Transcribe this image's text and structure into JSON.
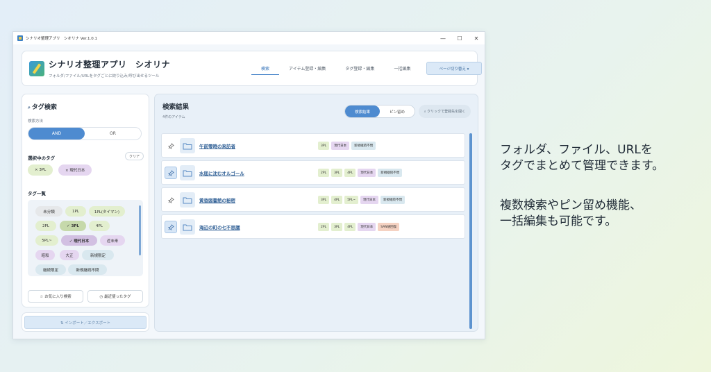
{
  "window": {
    "title": "シナリオ整理アプリ　シオリナ Ver.1.0.1",
    "controls": {
      "minimize": "—",
      "maximize": "☐",
      "close": "✕"
    }
  },
  "header": {
    "title": "シナリオ整理アプリ　シオリナ",
    "subtitle": "フォルダ/ファイル/URLをタグごとに絞り込み/呼び出せるツール",
    "tabs": [
      "検索",
      "アイテム登録・編集",
      "タグ登録・編集",
      "一括編集"
    ],
    "active_tab": 0,
    "page_switch": "ページ切り替え ▾"
  },
  "sidebar": {
    "title": "タグ検索",
    "search_mode_label": "検索方法",
    "mode_options": [
      "AND",
      "OR"
    ],
    "selected_label": "選択中のタグ",
    "clear": "クリア",
    "selected_tags": [
      "× 3PL",
      "× 現代日本"
    ],
    "tag_list_label": "タグ一覧",
    "tags": [
      {
        "text": "未分類",
        "color": "gray"
      },
      {
        "text": "1PL",
        "color": "green"
      },
      {
        "text": "1PL(タイマン)",
        "color": "green"
      },
      {
        "text": "2PL",
        "color": "green"
      },
      {
        "text": "✓ 3PL",
        "color": "greensel"
      },
      {
        "text": "4PL",
        "color": "green"
      },
      {
        "text": "5PL~",
        "color": "green"
      },
      {
        "text": "✓ 現代日本",
        "color": "purplesel"
      },
      {
        "text": "近未来",
        "color": "purple"
      },
      {
        "text": "昭和",
        "color": "purple"
      },
      {
        "text": "大正",
        "color": "purple"
      },
      {
        "text": "新規限定",
        "color": "blue"
      },
      {
        "text": "継続限定",
        "color": "blue"
      },
      {
        "text": "新規継続不問",
        "color": "blue"
      }
    ],
    "favorites": "☆ お気に入り検索",
    "recent": "◷ 最近使ったタグ",
    "import_export": "⇅ インポート／エクスポート"
  },
  "results": {
    "title": "検索結果",
    "count": "4件のアイテム",
    "view_options": [
      "検索結果",
      "ピン留め"
    ],
    "open_folder": "⌕ クリックで登録先を開く",
    "items": [
      {
        "name": "午前零時の来訪者",
        "pinned": false,
        "tags": [
          {
            "text": "3PL",
            "color": "green"
          },
          {
            "text": "現代日本",
            "color": "purple"
          },
          {
            "text": "新規継続不問",
            "color": "blue"
          }
        ]
      },
      {
        "name": "水底に沈むオルゴール",
        "pinned": true,
        "tags": [
          {
            "text": "2PL",
            "color": "green"
          },
          {
            "text": "3PL",
            "color": "green"
          },
          {
            "text": "4PL",
            "color": "green"
          },
          {
            "text": "現代日本",
            "color": "purple"
          },
          {
            "text": "新規継続不問",
            "color": "blue"
          }
        ]
      },
      {
        "name": "黄昏図書館の秘密",
        "pinned": false,
        "tags": [
          {
            "text": "3PL",
            "color": "green"
          },
          {
            "text": "4PL",
            "color": "green"
          },
          {
            "text": "5PL~",
            "color": "green"
          },
          {
            "text": "現代日本",
            "color": "purple"
          },
          {
            "text": "新規継続不問",
            "color": "blue"
          }
        ]
      },
      {
        "name": "海辺の町の七不思議",
        "pinned": true,
        "tags": [
          {
            "text": "2PL",
            "color": "green"
          },
          {
            "text": "3PL",
            "color": "green"
          },
          {
            "text": "4PL",
            "color": "green"
          },
          {
            "text": "現代日本",
            "color": "purple"
          },
          {
            "text": "SAN値回復",
            "color": "orange"
          }
        ]
      }
    ]
  },
  "promo": {
    "line1": "フォルダ、ファイル、URLを",
    "line2": "タグでまとめて管理できます。",
    "line3": "複数検索やピン留め機能、",
    "line4": "一括編集も可能です。"
  }
}
